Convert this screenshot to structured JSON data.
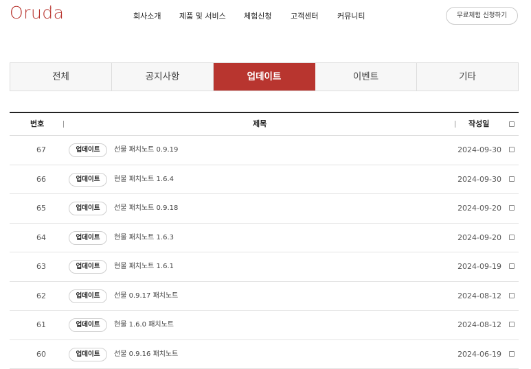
{
  "logo": {
    "text": "Oruda"
  },
  "nav": {
    "items": [
      "회사소개",
      "제품 및 서비스",
      "체험신청",
      "고객센터",
      "커뮤니티"
    ],
    "cta": "무료체험 신청하기"
  },
  "tabs": [
    {
      "label": "전체",
      "active": false
    },
    {
      "label": "공지사항",
      "active": false
    },
    {
      "label": "업데이트",
      "active": true
    },
    {
      "label": "이벤트",
      "active": false
    },
    {
      "label": "기타",
      "active": false
    }
  ],
  "table": {
    "headers": {
      "number": "번호",
      "title": "제목",
      "date": "작성일"
    },
    "rows": [
      {
        "number": "67",
        "category": "업데이트",
        "title": "선물 패치노트 0.9.19",
        "date": "2024-09-30"
      },
      {
        "number": "66",
        "category": "업데이트",
        "title": "현물 패치노트 1.6.4",
        "date": "2024-09-30"
      },
      {
        "number": "65",
        "category": "업데이트",
        "title": "선물 패치노트 0.9.18",
        "date": "2024-09-20"
      },
      {
        "number": "64",
        "category": "업데이트",
        "title": "현물 패치노트 1.6.3",
        "date": "2024-09-20"
      },
      {
        "number": "63",
        "category": "업데이트",
        "title": "현물 패치노트 1.6.1",
        "date": "2024-09-19"
      },
      {
        "number": "62",
        "category": "업데이트",
        "title": "선물 0.9.17 패치노트",
        "date": "2024-08-12"
      },
      {
        "number": "61",
        "category": "업데이트",
        "title": "현물 1.6.0 패치노트",
        "date": "2024-08-12"
      },
      {
        "number": "60",
        "category": "업데이트",
        "title": "선물 0.9.16 패치노트",
        "date": "2024-06-19"
      }
    ]
  },
  "colors": {
    "accent": "#b8352f"
  }
}
